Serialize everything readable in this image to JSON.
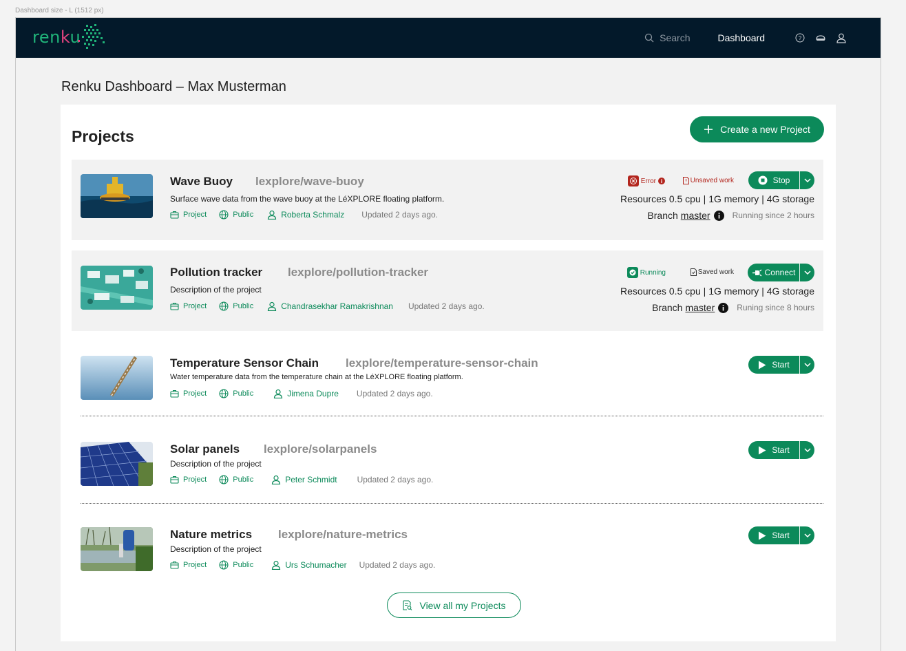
{
  "frame_label": "Dashboard size - L (1512 px)",
  "navbar": {
    "logo_text_a": "ren",
    "logo_text_k": "k",
    "logo_text_b": "u",
    "search_label": "Search",
    "dashboard_label": "Dashboard"
  },
  "page_title": "Renku Dashboard – Max Musterman",
  "projects_heading": "Projects",
  "create_button_label": "Create a new Project",
  "view_all_label": "View all my Projects",
  "colors": {
    "brand_green": "#0c8a5a",
    "navbar_bg": "#03192a",
    "error_red": "#b3261e"
  },
  "projects": [
    {
      "name": "Wave Buoy",
      "slug": "lexplore/wave-buoy",
      "description": "Surface wave data from the wave buoy at the LéXPLORE floating platform.",
      "type": "Project",
      "visibility": "Public",
      "owner": "Roberta Schmalz",
      "updated": "Updated 2 days ago.",
      "status": "Error",
      "work": "Unsaved work",
      "action": "Stop",
      "resources": {
        "label": "Resources",
        "cpu": "0.5 cpu",
        "memory": "1G memory",
        "storage": "4G storage"
      },
      "branch_label": "Branch",
      "branch": "master",
      "since": "Running since 2 hours"
    },
    {
      "name": "Pollution tracker",
      "slug": "lexplore/pollution-tracker",
      "description": "Description of the project",
      "type": "Project",
      "visibility": "Public",
      "owner": "Chandrasekhar Ramakrishnan",
      "updated": "Updated 2 days ago.",
      "status": "Running",
      "work": "Saved work",
      "action": "Connect",
      "resources": {
        "label": "Resources",
        "cpu": "0.5 cpu",
        "memory": "1G memory",
        "storage": "4G storage"
      },
      "branch_label": "Branch",
      "branch": "master",
      "since": "Runing since 8 hours"
    },
    {
      "name": "Temperature Sensor Chain",
      "slug": "lexplore/temperature-sensor-chain",
      "description": "Water temperature data from the temperature chain at the LéXPLORE floating platform.",
      "type": "Project",
      "visibility": "Public",
      "owner": "Jimena Dupre",
      "updated": "Updated 2 days ago.",
      "action": "Start"
    },
    {
      "name": "Solar panels",
      "slug": "lexplore/solarpanels",
      "description": "Description of the project",
      "type": "Project",
      "visibility": "Public",
      "owner": "Peter Schmidt",
      "updated": "Updated 2 days ago.",
      "action": "Start"
    },
    {
      "name": "Nature metrics",
      "slug": "lexplore/nature-metrics",
      "description": "Description of the project",
      "type": "Project",
      "visibility": "Public",
      "owner": "Urs Schumacher",
      "updated": "Updated 2 days ago.",
      "action": "Start"
    }
  ]
}
